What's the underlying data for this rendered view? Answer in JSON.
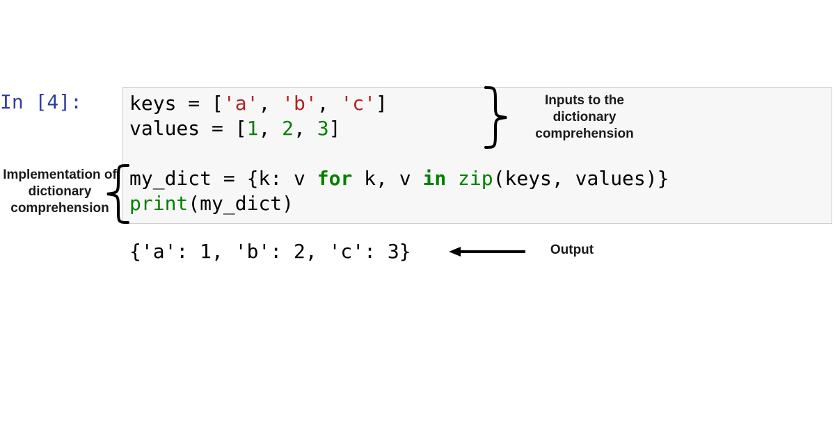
{
  "prompt": "In [4]:",
  "code": {
    "line1_pre": "keys ",
    "line1_eq": "=",
    "line1_sp": " [",
    "line1_close": "]",
    "str_a": "'a'",
    "str_b": "'b'",
    "str_c": "'c'",
    "comma": ", ",
    "line2_pre": "values ",
    "line2_eq": "=",
    "line2_sp": " [",
    "num_1": "1",
    "num_2": "2",
    "num_3": "3",
    "line3_a": "my_dict ",
    "line3_eq": "=",
    "line3_b": " {k: v ",
    "kw_for": "for",
    "line3_c": " k, v ",
    "kw_in": "in",
    "line3_d": " ",
    "fn_zip": "zip",
    "line3_e": "(keys, values)}",
    "fn_print": "print",
    "line4_a": "(my_dict)"
  },
  "output": "{'a': 1, 'b': 2, 'c': 3}",
  "annotations": {
    "inputs": "Inputs to the dictionary comprehension",
    "implementation": "Implementation of dictionary comprehension",
    "output": "Output"
  }
}
